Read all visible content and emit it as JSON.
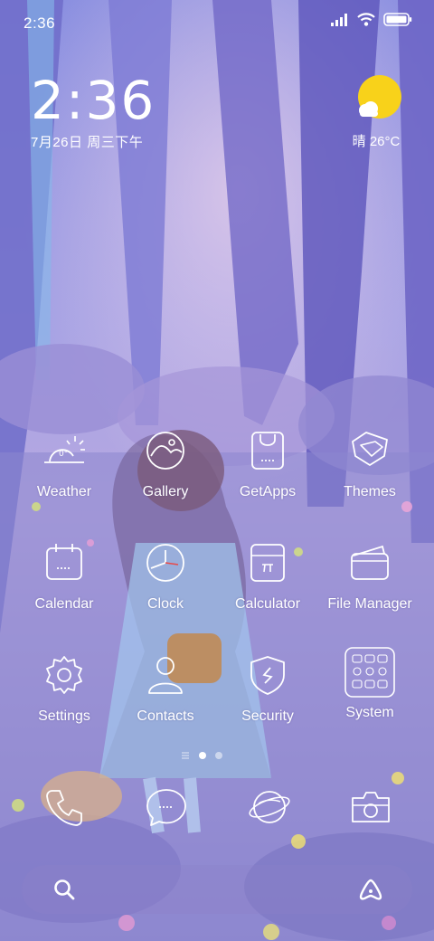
{
  "status_bar": {
    "time": "2:36",
    "icons": [
      "signal-icon",
      "wifi-icon",
      "battery-icon"
    ]
  },
  "clock_widget": {
    "time": "2:36",
    "date": "7月26日 周三下午"
  },
  "weather_widget": {
    "condition_icon": "sun-cloud-icon",
    "text": "晴 26°C",
    "sun_color": "#f8d21a"
  },
  "apps": [
    {
      "label": "Weather",
      "icon": "weather-icon"
    },
    {
      "label": "Gallery",
      "icon": "gallery-icon"
    },
    {
      "label": "GetApps",
      "icon": "getapps-icon"
    },
    {
      "label": "Themes",
      "icon": "themes-icon"
    },
    {
      "label": "Calendar",
      "icon": "calendar-icon"
    },
    {
      "label": "Clock",
      "icon": "clock-icon"
    },
    {
      "label": "Calculator",
      "icon": "calculator-icon"
    },
    {
      "label": "File Manager",
      "icon": "file-manager-icon"
    },
    {
      "label": "Settings",
      "icon": "settings-icon"
    },
    {
      "label": "Contacts",
      "icon": "contacts-icon"
    },
    {
      "label": "Security",
      "icon": "security-icon"
    },
    {
      "label": "System",
      "icon": "system-folder-icon"
    }
  ],
  "weather_icon_temp": "0°",
  "page_indicator": {
    "pages": 2,
    "current": 1
  },
  "dock": [
    "phone-icon",
    "messages-icon",
    "browser-icon",
    "camera-icon"
  ],
  "search_bar": {
    "left_icon": "search-icon",
    "right_icon": "assistant-icon"
  },
  "colors": {
    "wallpaper_base": "#8d8ad6",
    "clock_hand": "#e84a4a"
  }
}
